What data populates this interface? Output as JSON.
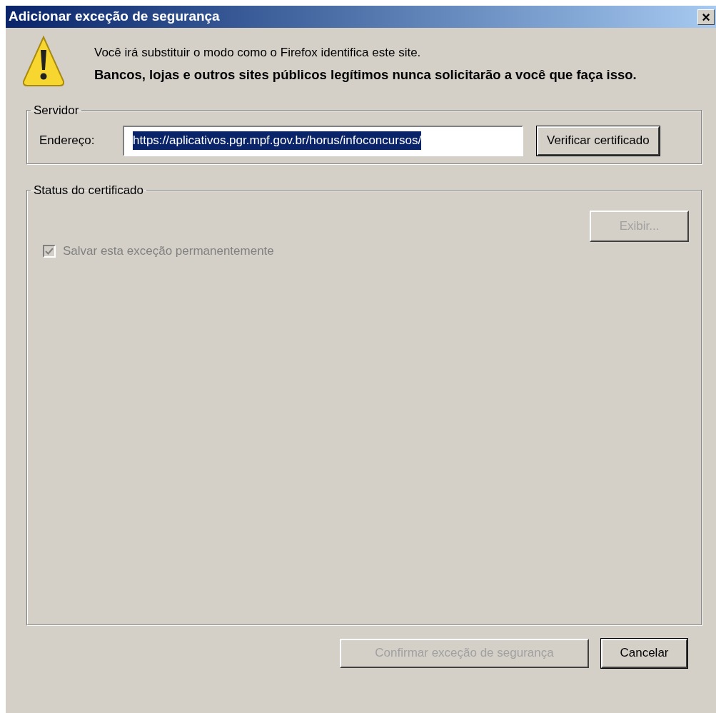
{
  "window": {
    "title": "Adicionar exceção de segurança",
    "close": "×"
  },
  "warning": {
    "line": "Você irá substituir o modo como o Firefox identifica este site.",
    "emphasis": "Bancos, lojas e outros sites públicos legítimos nunca solicitarão a você que faça isso."
  },
  "server": {
    "title": "Servidor",
    "address_label": "Endereço:",
    "address": {
      "value": "https://aplicativos.pgr.mpf.gov.br/horus/infoconcursos/",
      "selected": true
    },
    "check_button": {
      "label": "Verificar certificado",
      "disabled": false
    }
  },
  "status": {
    "title": "Status do certificado",
    "view_button": {
      "label": "Exibir...",
      "disabled": true
    },
    "save": {
      "label": "Salvar esta exceção permanentemente",
      "checked": true,
      "disabled": true
    }
  },
  "buttons": [
    {
      "label": "Confirmar exceção de segurança",
      "disabled": true
    },
    {
      "label": "Cancelar",
      "disabled": false
    }
  ]
}
